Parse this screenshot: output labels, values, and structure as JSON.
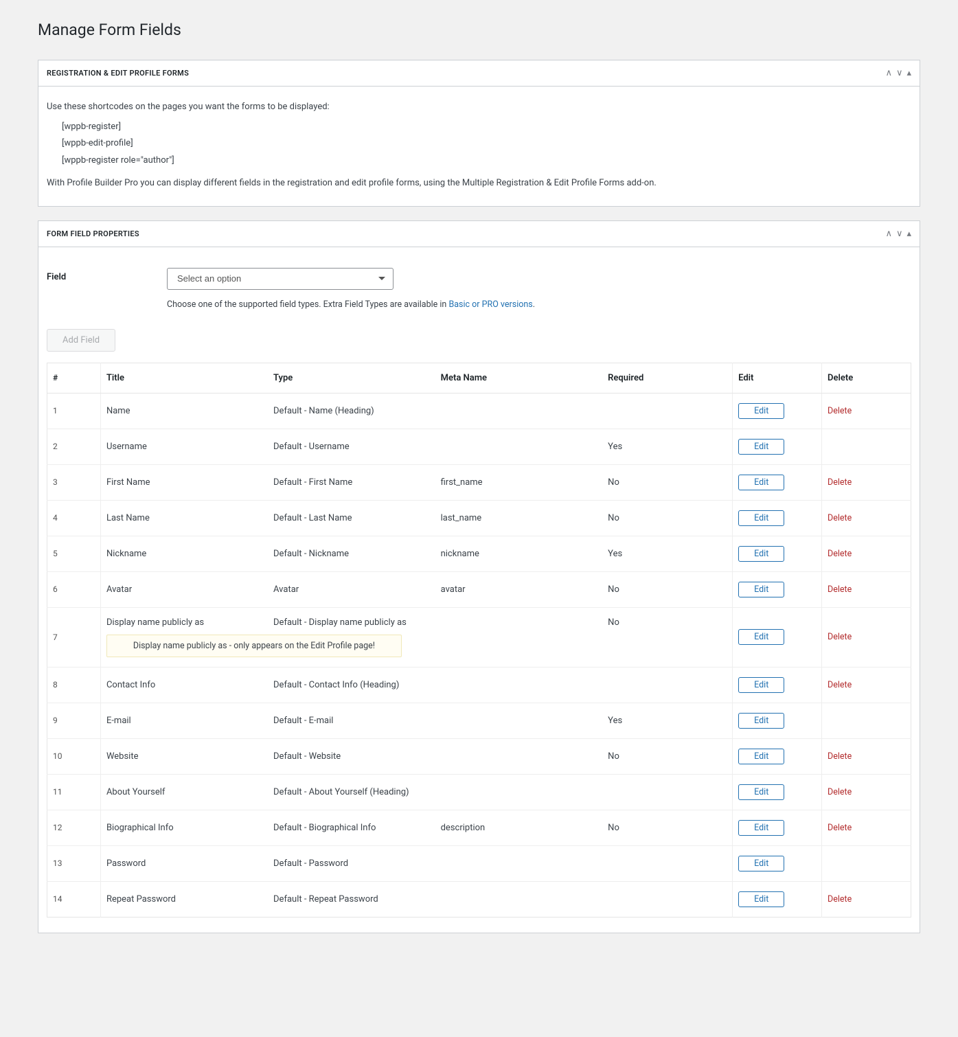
{
  "page": {
    "title": "Manage Form Fields"
  },
  "panel1": {
    "heading": "Registration & Edit Profile Forms",
    "intro": "Use these shortcodes on the pages you want the forms to be displayed:",
    "shortcodes": [
      "[wppb-register]",
      "[wppb-edit-profile]",
      "[wppb-register role=\"author\"]"
    ],
    "footer": "With Profile Builder Pro you can display different fields in the registration and edit profile forms, using the Multiple Registration & Edit Profile Forms add-on."
  },
  "panel2": {
    "heading": "Form Field Properties",
    "field_label": "Field",
    "select_placeholder": "Select an option",
    "help_prefix": "Choose one of the supported field types. Extra Field Types are available in ",
    "help_link": "Basic or PRO versions",
    "help_suffix": ".",
    "add_button": "Add Field"
  },
  "table": {
    "headers": {
      "idx": "#",
      "title": "Title",
      "type": "Type",
      "meta": "Meta Name",
      "required": "Required",
      "edit": "Edit",
      "delete": "Delete"
    },
    "edit_label": "Edit",
    "delete_label": "Delete",
    "rows": [
      {
        "n": "1",
        "title": "Name",
        "type": "Default - Name (Heading)",
        "meta": "",
        "required": "",
        "deletable": true,
        "notice": ""
      },
      {
        "n": "2",
        "title": "Username",
        "type": "Default - Username",
        "meta": "",
        "required": "Yes",
        "deletable": false,
        "notice": ""
      },
      {
        "n": "3",
        "title": "First Name",
        "type": "Default - First Name",
        "meta": "first_name",
        "required": "No",
        "deletable": true,
        "notice": ""
      },
      {
        "n": "4",
        "title": "Last Name",
        "type": "Default - Last Name",
        "meta": "last_name",
        "required": "No",
        "deletable": true,
        "notice": ""
      },
      {
        "n": "5",
        "title": "Nickname",
        "type": "Default - Nickname",
        "meta": "nickname",
        "required": "Yes",
        "deletable": true,
        "notice": ""
      },
      {
        "n": "6",
        "title": "Avatar",
        "type": "Avatar",
        "meta": "avatar",
        "required": "No",
        "deletable": true,
        "notice": ""
      },
      {
        "n": "7",
        "title": "Display name publicly as",
        "type": "Default - Display name publicly as",
        "meta": "",
        "required": "No",
        "deletable": true,
        "notice": "Display name publicly as - only appears on the Edit Profile page!"
      },
      {
        "n": "8",
        "title": "Contact Info",
        "type": "Default - Contact Info (Heading)",
        "meta": "",
        "required": "",
        "deletable": true,
        "notice": ""
      },
      {
        "n": "9",
        "title": "E-mail",
        "type": "Default - E-mail",
        "meta": "",
        "required": "Yes",
        "deletable": false,
        "notice": ""
      },
      {
        "n": "10",
        "title": "Website",
        "type": "Default - Website",
        "meta": "",
        "required": "No",
        "deletable": true,
        "notice": ""
      },
      {
        "n": "11",
        "title": "About Yourself",
        "type": "Default - About Yourself (Heading)",
        "meta": "",
        "required": "",
        "deletable": true,
        "notice": ""
      },
      {
        "n": "12",
        "title": "Biographical Info",
        "type": "Default - Biographical Info",
        "meta": "description",
        "required": "No",
        "deletable": true,
        "notice": ""
      },
      {
        "n": "13",
        "title": "Password",
        "type": "Default - Password",
        "meta": "",
        "required": "",
        "deletable": false,
        "notice": ""
      },
      {
        "n": "14",
        "title": "Repeat Password",
        "type": "Default - Repeat Password",
        "meta": "",
        "required": "",
        "deletable": true,
        "notice": ""
      }
    ]
  }
}
